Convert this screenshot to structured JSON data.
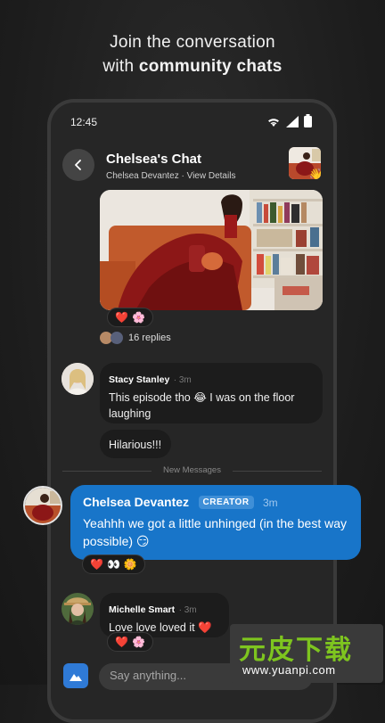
{
  "promo": {
    "line1": "Join the conversation",
    "line2_prefix": "with ",
    "line2_strong": "community chats"
  },
  "status_bar": {
    "time": "12:45"
  },
  "header": {
    "title": "Chelsea's Chat",
    "subtitle": "Chelsea Devantez · View Details"
  },
  "hero_post": {
    "reactions": [
      "❤️",
      "🌸"
    ],
    "replies_text": "16 replies"
  },
  "messages": [
    {
      "author": "Stacy Stanley",
      "time": "3m",
      "text": "This episode tho 😂 I was on the floor laughing"
    },
    {
      "text": "Hilarious!!!"
    }
  ],
  "divider_label": "New Messages",
  "creator_message": {
    "author": "Chelsea Devantez",
    "badge": "CREATOR",
    "time": "3m",
    "text": "Yeahhh we got a little unhinged (in the best way possible) 😏",
    "reactions": [
      "❤️",
      "👀",
      "🌼"
    ]
  },
  "message_3": {
    "author": "Michelle Smart",
    "time": "3m",
    "text": "Love love loved it ❤️",
    "reactions": [
      "❤️",
      "🌸"
    ]
  },
  "composer": {
    "placeholder": "Say anything..."
  },
  "watermark": {
    "title": "元皮下载",
    "url": "www.yuanpi.com"
  },
  "colors": {
    "creator_bubble": "#1875c9",
    "background": "#1c1c1c",
    "bubble": "#1c1c1c"
  }
}
